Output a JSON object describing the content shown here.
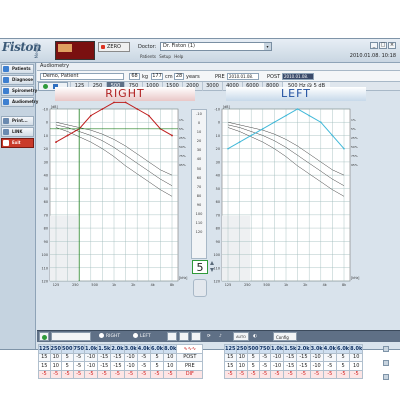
{
  "app": {
    "logo_text": "Fiston",
    "logo_sub": "Medical",
    "zero_label": "ZERO",
    "doctor_label": "Doctor:",
    "doctor_value": "Dr. Fiston (1)",
    "menu": "Patients  Setup  Help",
    "datetime": "2010.01.08. 10:18",
    "window_controls": [
      "_",
      "□",
      "×"
    ]
  },
  "sidebar": {
    "items": [
      {
        "label": "Patients",
        "icon": "patients-icon",
        "color": "#3d7fd0"
      },
      {
        "label": "Diagnose",
        "icon": "diagnose-icon",
        "color": "#3d7fd0"
      },
      {
        "label": "Spirometry",
        "icon": "spirometry-icon",
        "color": "#3d7fd0"
      },
      {
        "label": "Audiometry",
        "icon": "audiometry-icon",
        "color": "#3d7fd0"
      },
      {
        "label": "Print...",
        "icon": "print-icon",
        "color": "#6a8ab0"
      },
      {
        "label": "LINK",
        "icon": "link-icon",
        "color": "#6a8ab0"
      },
      {
        "label": "Exit",
        "icon": "exit-icon",
        "color": "#ffffff"
      }
    ]
  },
  "header": {
    "module": "Audiometry",
    "patient": "Demo, Patient",
    "weight": "68",
    "weight_unit": "kg",
    "height": "177",
    "height_unit": "cm",
    "age": "28",
    "age_unit": "years",
    "pre_label": "PRE",
    "pre_date": "2010.01.08.",
    "post_label": "POST",
    "post_date": "2010.01.08."
  },
  "frequencies": [
    "125",
    "250",
    "500",
    "750",
    "1000",
    "1500",
    "2000",
    "3000",
    "4000",
    "6000",
    "8000"
  ],
  "freq_status": "500 Hz @ 5 dB",
  "charts": {
    "right_title": "RIGHT",
    "left_title": "LEFT",
    "y_ticks": [
      "-10",
      "0",
      "10",
      "20",
      "30",
      "40",
      "50",
      "60",
      "70",
      "80",
      "90",
      "100",
      "110",
      "120"
    ],
    "x_ticks": [
      "125",
      "250",
      "500",
      "1k",
      "2k",
      "4k",
      "8k"
    ],
    "x_unit": "[kHz]",
    "y_unit": "[dB]",
    "percent_labels": [
      "1%",
      "5%",
      "25%",
      "50%",
      "75%",
      "95%"
    ],
    "colors": {
      "right": "#c02020",
      "left": "#40b8d8",
      "cursor": "#208020",
      "norms": "#404040",
      "grid": "#9ab8b8"
    }
  },
  "chart_data": [
    {
      "type": "line",
      "title": "RIGHT",
      "x": [
        "125",
        "250",
        "500",
        "750",
        "1k",
        "1.5k",
        "2k",
        "3k",
        "4k",
        "6k",
        "8k"
      ],
      "ylabel": "[dB]",
      "xlabel": "[kHz]",
      "ylim": [
        -10,
        120
      ],
      "y_inverted": true,
      "series": [
        {
          "name": "POST",
          "values": [
            15,
            10,
            5,
            -5,
            -10,
            -15,
            -15,
            -10,
            -5,
            5,
            10
          ]
        },
        {
          "name": "PRE",
          "values": [
            15,
            10,
            5,
            -5,
            -10,
            -15,
            -15,
            -10,
            -5,
            5,
            10
          ]
        }
      ]
    },
    {
      "type": "line",
      "title": "LEFT",
      "x": [
        "125",
        "250",
        "500",
        "750",
        "1k",
        "1.5k",
        "2k",
        "3k",
        "4k",
        "6k",
        "8k"
      ],
      "ylabel": "[dB]",
      "xlabel": "[kHz]",
      "ylim": [
        -10,
        120
      ],
      "y_inverted": true,
      "series": [
        {
          "name": "POST",
          "values": [
            20,
            15,
            10,
            5,
            0,
            -5,
            -10,
            -5,
            0,
            10,
            20
          ]
        }
      ]
    }
  ],
  "mid_panel": {
    "scale": [
      "-10",
      "0",
      "10",
      "20",
      "30",
      "40",
      "50",
      "60",
      "70",
      "80",
      "90",
      "100",
      "110",
      "120"
    ],
    "value": "5"
  },
  "toolbar": {
    "right_label": "RIGHT",
    "left_label": "LEFT",
    "config_label": "Config",
    "auto_label": "AUTO"
  },
  "table": {
    "headers": [
      "125",
      "250",
      "500",
      "750",
      "1.0k",
      "1.5k",
      "2.0k",
      "3.0k",
      "4.0k",
      "6.0k",
      "8.0k"
    ],
    "rows": [
      {
        "name": "POST",
        "values": [
          "15",
          "10",
          "5",
          "-5",
          "-10",
          "-15",
          "-15",
          "-10",
          "-5",
          "5",
          "10"
        ]
      },
      {
        "name": "PRE",
        "values": [
          "15",
          "10",
          "5",
          "-5",
          "-10",
          "-15",
          "-15",
          "-10",
          "-5",
          "5",
          "10"
        ]
      },
      {
        "name": "DIF",
        "values": [
          "-5",
          "-5",
          "-5",
          "-5",
          "-5",
          "-5",
          "-5",
          "-5",
          "-5",
          "-5",
          "-5"
        ]
      }
    ],
    "right_rows": [
      [
        "15",
        "10",
        "5",
        "-5",
        "-10",
        "-15",
        "-15",
        "-10",
        "-5",
        "5",
        "10"
      ],
      [
        "15",
        "10",
        "5",
        "-5",
        "-10",
        "-15",
        "-15",
        "-10",
        "-5",
        "5",
        "10"
      ],
      [
        "-5",
        "-5",
        "-5",
        "-5",
        "-5",
        "-5",
        "-5",
        "-5",
        "-5",
        "-5",
        "-5"
      ]
    ]
  }
}
